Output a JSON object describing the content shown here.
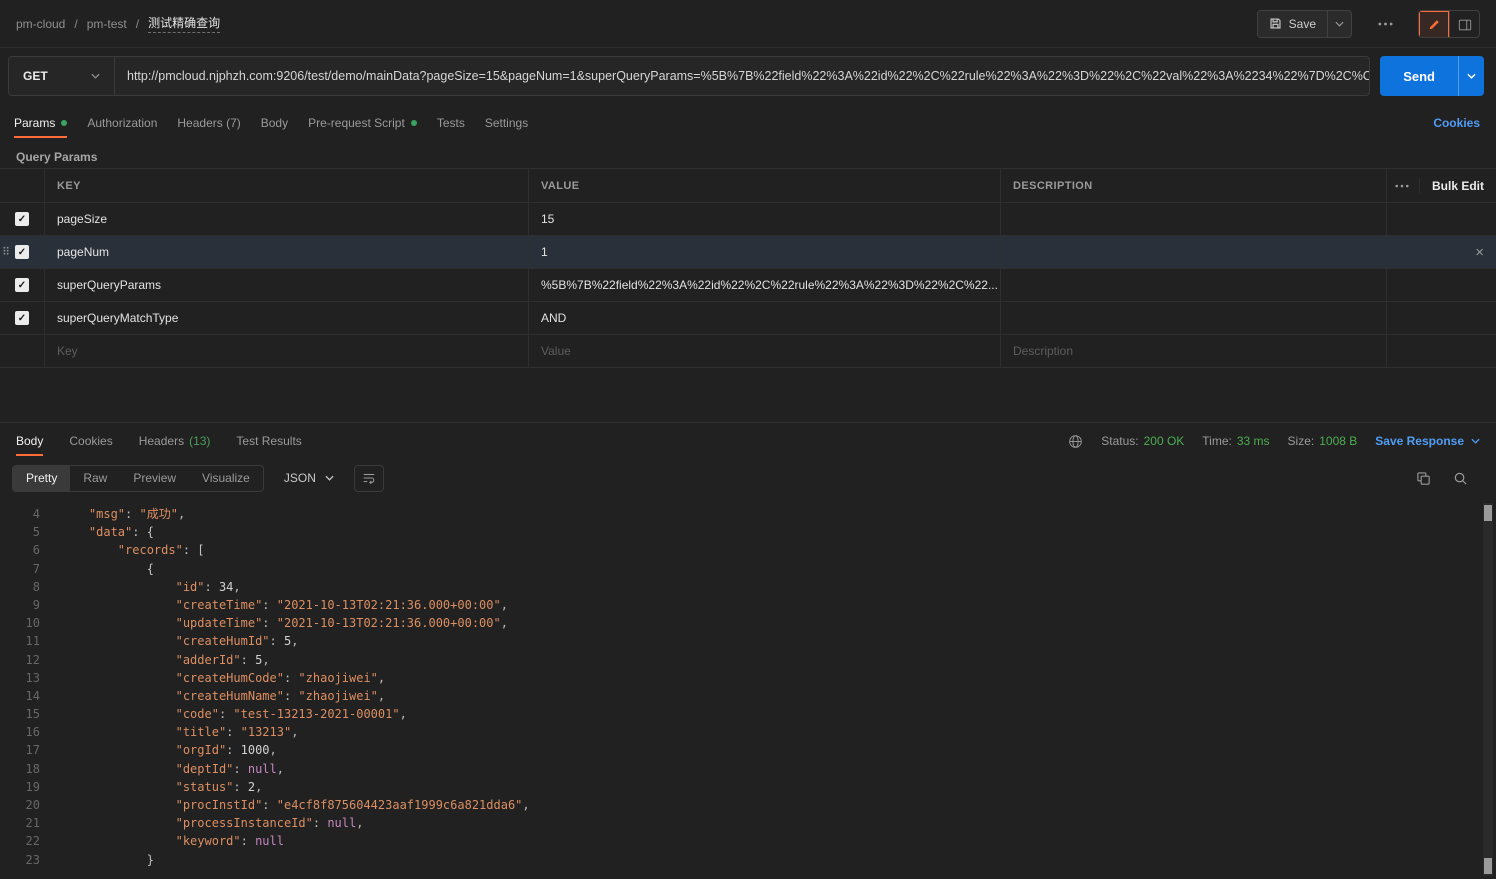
{
  "topbar": {
    "breadcrumb": [
      "pm-cloud",
      "pm-test",
      "测试精确查询"
    ],
    "save_label": "Save"
  },
  "request": {
    "method": "GET",
    "url": "http://pmcloud.njphzh.com:9206/test/demo/mainData?pageSize=15&pageNum=1&superQueryParams=%5B%7B%22field%22%3A%22id%22%2C%22rule%22%3A%22%3D%22%2C%22val%22%3A%2234%22%7D%2C%C",
    "send_label": "Send"
  },
  "request_tabs": {
    "items": [
      {
        "label": "Params",
        "dot": true,
        "active": true
      },
      {
        "label": "Authorization",
        "dot": false,
        "active": false
      },
      {
        "label": "Headers (7)",
        "dot": false,
        "active": false
      },
      {
        "label": "Body",
        "dot": false,
        "active": false
      },
      {
        "label": "Pre-request Script",
        "dot": true,
        "active": false
      },
      {
        "label": "Tests",
        "dot": false,
        "active": false
      },
      {
        "label": "Settings",
        "dot": false,
        "active": false
      }
    ],
    "cookies_link": "Cookies"
  },
  "params": {
    "section_title": "Query Params",
    "columns": [
      "KEY",
      "VALUE",
      "DESCRIPTION"
    ],
    "bulk_edit_label": "Bulk Edit",
    "rows": [
      {
        "checked": true,
        "selected": false,
        "key": "pageSize",
        "value": "15",
        "description": ""
      },
      {
        "checked": true,
        "selected": true,
        "key": "pageNum",
        "value": "1",
        "description": ""
      },
      {
        "checked": true,
        "selected": false,
        "key": "superQueryParams",
        "value": "%5B%7B%22field%22%3A%22id%22%2C%22rule%22%3A%22%3D%22%2C%22...",
        "description": ""
      },
      {
        "checked": true,
        "selected": false,
        "key": "superQueryMatchType",
        "value": "AND",
        "description": ""
      }
    ],
    "placeholder_row": {
      "key": "Key",
      "value": "Value",
      "description": "Description"
    }
  },
  "response": {
    "tabs": [
      {
        "label": "Body",
        "count": "",
        "active": true
      },
      {
        "label": "Cookies",
        "count": "",
        "active": false
      },
      {
        "label": "Headers",
        "count": "(13)",
        "active": false
      },
      {
        "label": "Test Results",
        "count": "",
        "active": false
      }
    ],
    "meta": {
      "status_label": "Status:",
      "status_value": "200 OK",
      "time_label": "Time:",
      "time_value": "33 ms",
      "size_label": "Size:",
      "size_value": "1008 B",
      "save_response_label": "Save Response"
    },
    "view_tabs": [
      "Pretty",
      "Raw",
      "Preview",
      "Visualize"
    ],
    "active_view": "Pretty",
    "format": "JSON",
    "code": {
      "lines": [
        {
          "num": 4,
          "ind": 1,
          "t": [
            {
              "c": "k",
              "v": "\"msg\""
            },
            {
              "c": "p",
              "v": ": "
            },
            {
              "c": "s",
              "v": "\"成功\""
            },
            {
              "c": "p",
              "v": ","
            }
          ]
        },
        {
          "num": 5,
          "ind": 1,
          "t": [
            {
              "c": "k",
              "v": "\"data\""
            },
            {
              "c": "p",
              "v": ": "
            },
            {
              "c": "b",
              "v": "{"
            }
          ]
        },
        {
          "num": 6,
          "ind": 2,
          "t": [
            {
              "c": "k",
              "v": "\"records\""
            },
            {
              "c": "p",
              "v": ": "
            },
            {
              "c": "b",
              "v": "["
            }
          ]
        },
        {
          "num": 7,
          "ind": 3,
          "t": [
            {
              "c": "b",
              "v": "{"
            }
          ]
        },
        {
          "num": 8,
          "ind": 4,
          "t": [
            {
              "c": "k",
              "v": "\"id\""
            },
            {
              "c": "p",
              "v": ": "
            },
            {
              "c": "n",
              "v": "34"
            },
            {
              "c": "p",
              "v": ","
            }
          ]
        },
        {
          "num": 9,
          "ind": 4,
          "t": [
            {
              "c": "k",
              "v": "\"createTime\""
            },
            {
              "c": "p",
              "v": ": "
            },
            {
              "c": "s",
              "v": "\"2021-10-13T02:21:36.000+00:00\""
            },
            {
              "c": "p",
              "v": ","
            }
          ]
        },
        {
          "num": 10,
          "ind": 4,
          "t": [
            {
              "c": "k",
              "v": "\"updateTime\""
            },
            {
              "c": "p",
              "v": ": "
            },
            {
              "c": "s",
              "v": "\"2021-10-13T02:21:36.000+00:00\""
            },
            {
              "c": "p",
              "v": ","
            }
          ]
        },
        {
          "num": 11,
          "ind": 4,
          "t": [
            {
              "c": "k",
              "v": "\"createHumId\""
            },
            {
              "c": "p",
              "v": ": "
            },
            {
              "c": "n",
              "v": "5"
            },
            {
              "c": "p",
              "v": ","
            }
          ]
        },
        {
          "num": 12,
          "ind": 4,
          "t": [
            {
              "c": "k",
              "v": "\"adderId\""
            },
            {
              "c": "p",
              "v": ": "
            },
            {
              "c": "n",
              "v": "5"
            },
            {
              "c": "p",
              "v": ","
            }
          ]
        },
        {
          "num": 13,
          "ind": 4,
          "t": [
            {
              "c": "k",
              "v": "\"createHumCode\""
            },
            {
              "c": "p",
              "v": ": "
            },
            {
              "c": "s",
              "v": "\"zhaojiwei\""
            },
            {
              "c": "p",
              "v": ","
            }
          ]
        },
        {
          "num": 14,
          "ind": 4,
          "t": [
            {
              "c": "k",
              "v": "\"createHumName\""
            },
            {
              "c": "p",
              "v": ": "
            },
            {
              "c": "s",
              "v": "\"zhaojiwei\""
            },
            {
              "c": "p",
              "v": ","
            }
          ]
        },
        {
          "num": 15,
          "ind": 4,
          "t": [
            {
              "c": "k",
              "v": "\"code\""
            },
            {
              "c": "p",
              "v": ": "
            },
            {
              "c": "s",
              "v": "\"test-13213-2021-00001\""
            },
            {
              "c": "p",
              "v": ","
            }
          ]
        },
        {
          "num": 16,
          "ind": 4,
          "t": [
            {
              "c": "k",
              "v": "\"title\""
            },
            {
              "c": "p",
              "v": ": "
            },
            {
              "c": "s",
              "v": "\"13213\""
            },
            {
              "c": "p",
              "v": ","
            }
          ]
        },
        {
          "num": 17,
          "ind": 4,
          "t": [
            {
              "c": "k",
              "v": "\"orgId\""
            },
            {
              "c": "p",
              "v": ": "
            },
            {
              "c": "n",
              "v": "1000"
            },
            {
              "c": "p",
              "v": ","
            }
          ]
        },
        {
          "num": 18,
          "ind": 4,
          "t": [
            {
              "c": "k",
              "v": "\"deptId\""
            },
            {
              "c": "p",
              "v": ": "
            },
            {
              "c": "u",
              "v": "null"
            },
            {
              "c": "p",
              "v": ","
            }
          ]
        },
        {
          "num": 19,
          "ind": 4,
          "t": [
            {
              "c": "k",
              "v": "\"status\""
            },
            {
              "c": "p",
              "v": ": "
            },
            {
              "c": "n",
              "v": "2"
            },
            {
              "c": "p",
              "v": ","
            }
          ]
        },
        {
          "num": 20,
          "ind": 4,
          "t": [
            {
              "c": "k",
              "v": "\"procInstId\""
            },
            {
              "c": "p",
              "v": ": "
            },
            {
              "c": "s",
              "v": "\"e4cf8f875604423aaf1999c6a821dda6\""
            },
            {
              "c": "p",
              "v": ","
            }
          ]
        },
        {
          "num": 21,
          "ind": 4,
          "t": [
            {
              "c": "k",
              "v": "\"processInstanceId\""
            },
            {
              "c": "p",
              "v": ": "
            },
            {
              "c": "u",
              "v": "null"
            },
            {
              "c": "p",
              "v": ","
            }
          ]
        },
        {
          "num": 22,
          "ind": 4,
          "t": [
            {
              "c": "k",
              "v": "\"keyword\""
            },
            {
              "c": "p",
              "v": ": "
            },
            {
              "c": "u",
              "v": "null"
            }
          ]
        },
        {
          "num": 23,
          "ind": 3,
          "t": [
            {
              "c": "b",
              "v": "}"
            }
          ]
        }
      ]
    }
  },
  "icons": {
    "check": "✓",
    "close": "×",
    "drag": "⠿",
    "separator": "/"
  }
}
